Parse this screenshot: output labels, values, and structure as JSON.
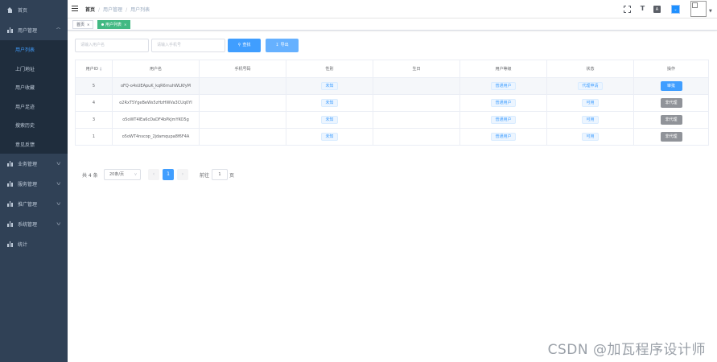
{
  "sidebar": {
    "items": [
      {
        "label": "首页"
      },
      {
        "label": "用户管理",
        "expanded": true,
        "children": [
          {
            "label": "用户列表",
            "active": true
          },
          {
            "label": "上门地址"
          },
          {
            "label": "用户收藏"
          },
          {
            "label": "用户足迹"
          },
          {
            "label": "搜索历史"
          },
          {
            "label": "意见反馈"
          }
        ]
      },
      {
        "label": "业务管理"
      },
      {
        "label": "服务管理"
      },
      {
        "label": "推广管理"
      },
      {
        "label": "系统管理"
      },
      {
        "label": "统计"
      }
    ]
  },
  "navbar": {
    "breadcrumb": [
      "首页",
      "用户管理",
      "用户列表"
    ],
    "lang_icon": "A",
    "size_icon": "T"
  },
  "tags": [
    {
      "label": "首页"
    },
    {
      "label": "用户列表",
      "active": true
    }
  ],
  "search": {
    "username_placeholder": "请输入用户名",
    "phone_placeholder": "请输入手机号",
    "search_label": "查找",
    "export_label": "导出"
  },
  "table": {
    "columns": [
      "用户ID",
      "用户名",
      "手机号码",
      "性别",
      "生日",
      "用户等级",
      "状态",
      "操作"
    ],
    "rows": [
      {
        "id": "5",
        "username": "oFQ-o4sUEApuK_kqR6muhWLKfyM",
        "phone": "",
        "gender": "未知",
        "birthday": "",
        "level": "普通用户",
        "status": "代理申请",
        "action": "审批",
        "highlight": true
      },
      {
        "id": "4",
        "username": "o2RxT5YgeBeWs5zHzHWVa3CUq0YI",
        "phone": "",
        "gender": "未知",
        "birthday": "",
        "level": "普通用户",
        "status": "可用",
        "action": "非代理",
        "highlight": false
      },
      {
        "id": "3",
        "username": "o5oWT4lEa6cDaDF4bPkJmYKO5g",
        "phone": "",
        "gender": "未知",
        "birthday": "",
        "level": "普通用户",
        "status": "可用",
        "action": "非代理",
        "highlight": false
      },
      {
        "id": "1",
        "username": "o5oWT4nscop_2jdamqupa8f6F4A",
        "phone": "",
        "gender": "未知",
        "birthday": "",
        "level": "普通用户",
        "status": "可用",
        "action": "非代理",
        "highlight": false
      }
    ]
  },
  "pagination": {
    "total": "共 4 条",
    "page_size": "20条/页",
    "current": "1",
    "goto_label": "前往",
    "goto_value": "1",
    "page_suffix": "页"
  },
  "watermark": "CSDN @加瓦程序设计师",
  "colors": {
    "sidebar_bg": "#304156",
    "submenu_bg": "#1f2d3d",
    "primary": "#409eff",
    "tag_active": "#42b983",
    "info": "#909399"
  }
}
